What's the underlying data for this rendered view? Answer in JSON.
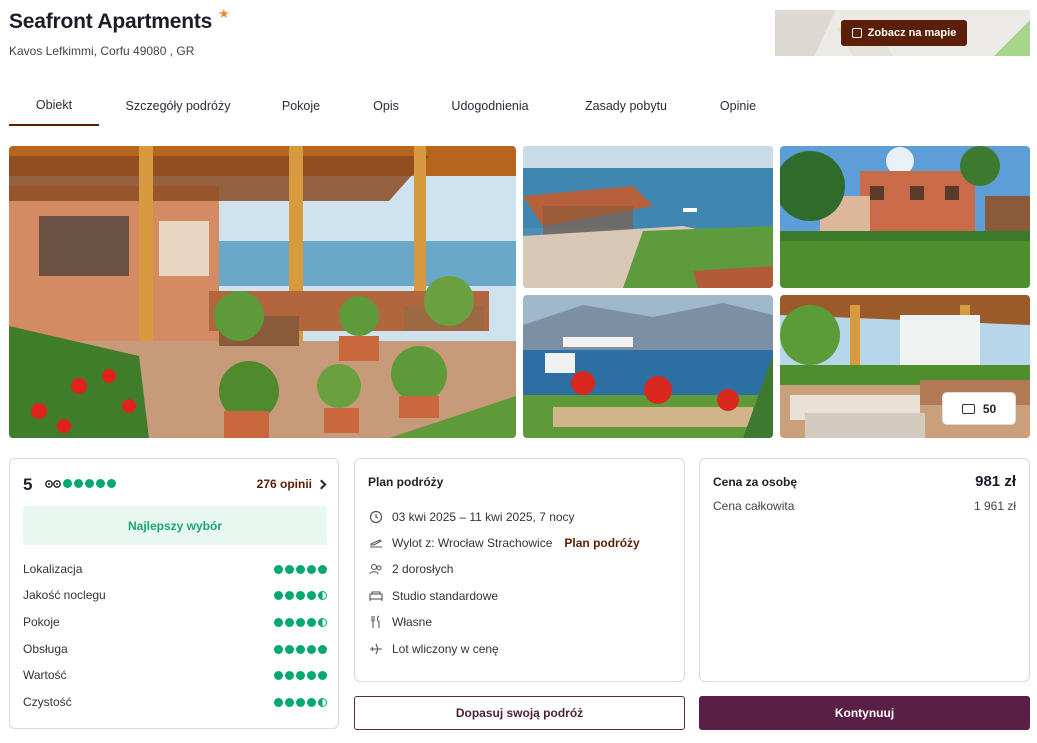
{
  "header": {
    "title": "Seafront Apartments",
    "star": "★",
    "address": "Kavos Lefkimmi, Corfu 49080 , GR",
    "map_button": "Zobacz na mapie"
  },
  "tabs": [
    {
      "label": "Obiekt",
      "active": true
    },
    {
      "label": "Szczegóły podróży"
    },
    {
      "label": "Pokoje"
    },
    {
      "label": "Opis"
    },
    {
      "label": "Udogodnienia"
    },
    {
      "label": "Zasady pobytu"
    },
    {
      "label": "Opinie"
    }
  ],
  "gallery": {
    "photo_count": "50",
    "photos": [
      "bar-terrace-photo",
      "beach-gazebo-photo",
      "garden-building-photo",
      "sea-view-photo",
      "terrace-sofas-photo"
    ]
  },
  "rating": {
    "score": "5",
    "score_bubbles": 5,
    "reviews_link": "276 opinii",
    "badge": "Najlepszy wybór",
    "criteria": [
      {
        "label": "Lokalizacja",
        "value": 5
      },
      {
        "label": "Jakość noclegu",
        "value": 4.5
      },
      {
        "label": "Pokoje",
        "value": 4.5
      },
      {
        "label": "Obsługa",
        "value": 5
      },
      {
        "label": "Wartość",
        "value": 5
      },
      {
        "label": "Czystość",
        "value": 4.5
      }
    ]
  },
  "plan": {
    "title": "Plan podróży",
    "dates": "03 kwi 2025 – 11 kwi 2025, 7 nocy",
    "departure": "Wylot z: Wrocław Strachowice",
    "departure_link": "Plan podróży",
    "guests": "2 dorosłych",
    "room": "Studio standardowe",
    "board": "Własne",
    "flight": "Lot wliczony w cenę"
  },
  "price": {
    "per_person_label": "Cena za osobę",
    "per_person_value": "981 zł",
    "total_label": "Cena całkowita",
    "total_value": "1 961 zł"
  },
  "buttons": {
    "customize": "Dopasuj swoją podróż",
    "continue": "Kontynuuj"
  },
  "colors": {
    "brand_dark": "#5a1f06",
    "primary": "#5a1f47",
    "tripadvisor_green": "#00aa6c",
    "star": "#f08a24"
  }
}
